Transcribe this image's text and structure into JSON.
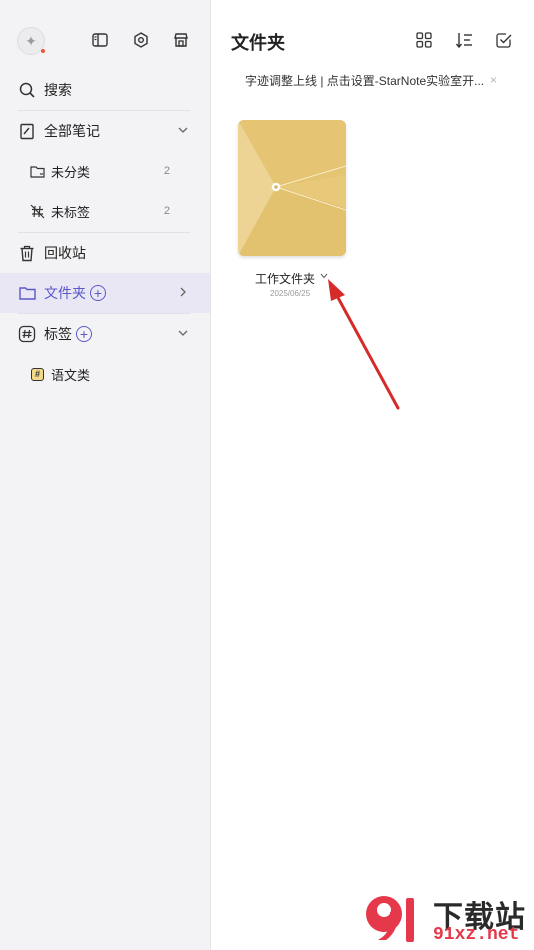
{
  "sidebar": {
    "search_label": "搜索",
    "all_notes_label": "全部笔记",
    "uncategorized_label": "未分类",
    "uncategorized_count": "2",
    "untagged_label": "未标签",
    "untagged_count": "2",
    "trash_label": "回收站",
    "folders_label": "文件夹",
    "tags_label": "标签",
    "tag_items": [
      {
        "label": "语文类",
        "chip": "#"
      }
    ],
    "accent_color": "#5b58c9"
  },
  "main": {
    "title": "文件夹",
    "notice": "字迹调整上线 | 点击设置-StarNote实验室开...",
    "notice_close": "×",
    "folders": [
      {
        "name": "工作文件夹",
        "date": "2025/06/25",
        "color": "#e8c97a"
      }
    ]
  },
  "watermark": {
    "title": "下载站",
    "url": "91xz.net"
  },
  "icons": {
    "logo": "sparkle-icon",
    "panel": "sidebar-toggle-icon",
    "settings": "hexagon-settings-icon",
    "store": "store-icon",
    "grid": "grid-view-icon",
    "sort": "sort-icon",
    "select": "check-select-icon"
  }
}
